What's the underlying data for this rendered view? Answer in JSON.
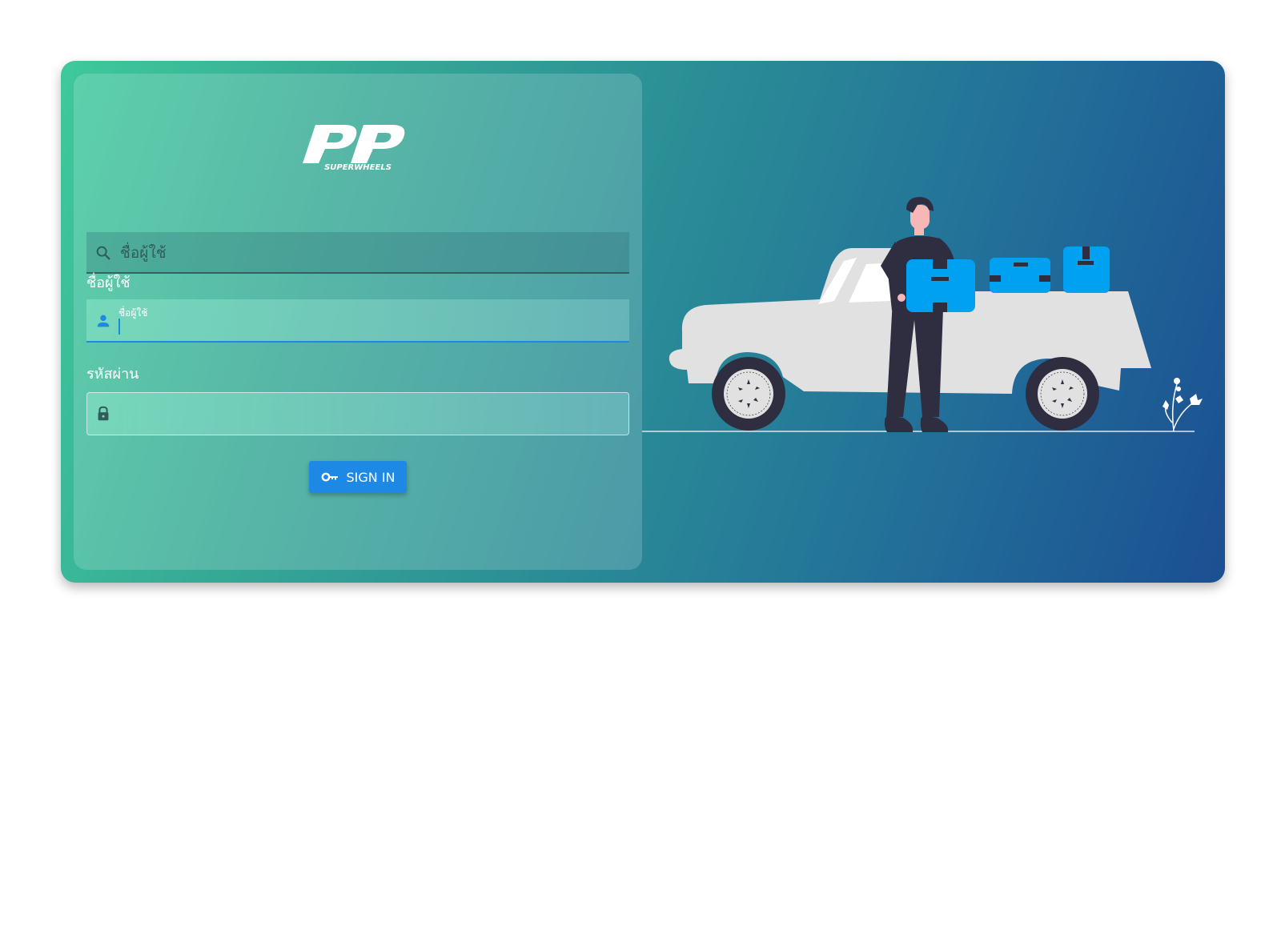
{
  "brand": {
    "logo_text": "PP",
    "logo_subtext": "SUPERWHEELS"
  },
  "search": {
    "placeholder": "ชื่อผู้ใช้",
    "icon": "search-icon"
  },
  "username": {
    "label": "ชื่อผู้ใช้",
    "floating_label": "ชื่อผู้ใช้",
    "value": "",
    "icon": "person-icon"
  },
  "password": {
    "label": "รหัสผ่าน",
    "value": "",
    "icon": "lock-icon"
  },
  "signin": {
    "label": "SIGN IN",
    "icon": "key-icon"
  },
  "colors": {
    "accent": "#1e88e5",
    "gradient_start": "#3ec99b",
    "gradient_end": "#1b4f92",
    "box_blue": "#00a1f1"
  }
}
